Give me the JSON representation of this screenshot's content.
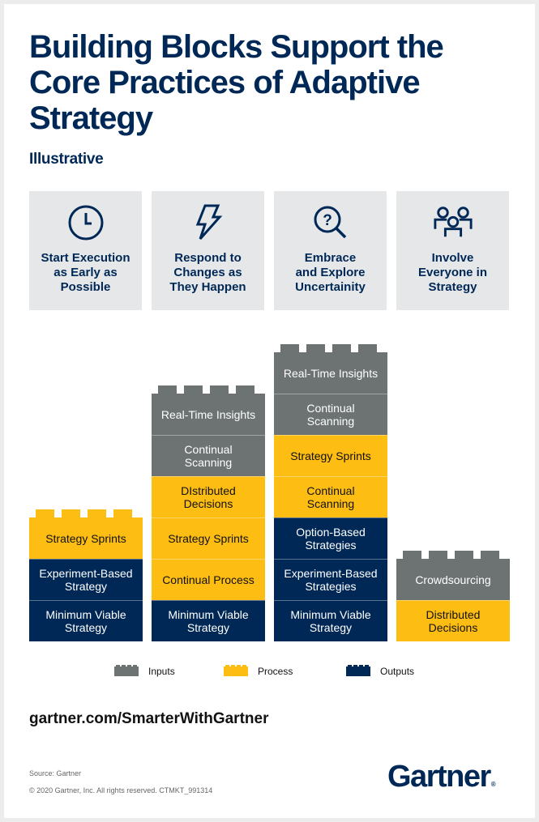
{
  "header": {
    "title": "Building Blocks Support the Core Practices of Adaptive Strategy",
    "subtitle": "Illustrative"
  },
  "colors": {
    "navy": "#002856",
    "inputs": "#6d7373",
    "process": "#fdbd13",
    "outputs": "#002856",
    "card_bg": "#e6e7e9"
  },
  "practices": [
    {
      "icon": "clock-icon",
      "label": "Start Execution\nas Early as\nPossible"
    },
    {
      "icon": "lightning-icon",
      "label": "Respond to\nChanges as\nThey Happen"
    },
    {
      "icon": "search-question-icon",
      "label": "Embrace\nand Explore\nUncertainity"
    },
    {
      "icon": "people-group-icon",
      "label": "Involve\nEveryone in\nStrategy"
    }
  ],
  "stacks": [
    {
      "practice": "Start Execution as Early as Possible",
      "blocks_top_to_bottom": [
        {
          "label": "Strategy Sprints",
          "type": "process"
        },
        {
          "label": "Experiment-Based\nStrategy",
          "type": "outputs"
        },
        {
          "label": "Minimum Viable\nStrategy",
          "type": "outputs"
        }
      ]
    },
    {
      "practice": "Respond to Changes as They Happen",
      "blocks_top_to_bottom": [
        {
          "label": "Real-Time Insights",
          "type": "inputs"
        },
        {
          "label": "Continual\nScanning",
          "type": "inputs"
        },
        {
          "label": "DIstributed\nDecisions",
          "type": "process"
        },
        {
          "label": "Strategy Sprints",
          "type": "process"
        },
        {
          "label": "Continual Process",
          "type": "process"
        },
        {
          "label": "Minimum Viable\nStrategy",
          "type": "outputs"
        }
      ]
    },
    {
      "practice": "Embrace and Explore Uncertainity",
      "blocks_top_to_bottom": [
        {
          "label": "Real-Time Insights",
          "type": "inputs"
        },
        {
          "label": "Continual\nScanning",
          "type": "inputs"
        },
        {
          "label": "Strategy Sprints",
          "type": "process"
        },
        {
          "label": "Continual\nScanning",
          "type": "process"
        },
        {
          "label": "Option-Based\nStrategies",
          "type": "outputs"
        },
        {
          "label": "Experiment-Based\nStrategies",
          "type": "outputs"
        },
        {
          "label": "Minimum Viable\nStrategy",
          "type": "outputs"
        }
      ]
    },
    {
      "practice": "Involve Everyone in Strategy",
      "blocks_top_to_bottom": [
        {
          "label": "Crowdsourcing",
          "type": "inputs"
        },
        {
          "label": "Distributed\nDecisions",
          "type": "process"
        }
      ]
    }
  ],
  "legend": [
    {
      "label": "Inputs",
      "type": "inputs"
    },
    {
      "label": "Process",
      "type": "process"
    },
    {
      "label": "Outputs",
      "type": "outputs"
    }
  ],
  "footer": {
    "url": "gartner.com/SmarterWithGartner",
    "source": "Source: Gartner",
    "copyright": "© 2020 Gartner, Inc. All rights reserved. CTMKT_991314",
    "logo": "Gartner",
    "logo_mark": "®"
  }
}
